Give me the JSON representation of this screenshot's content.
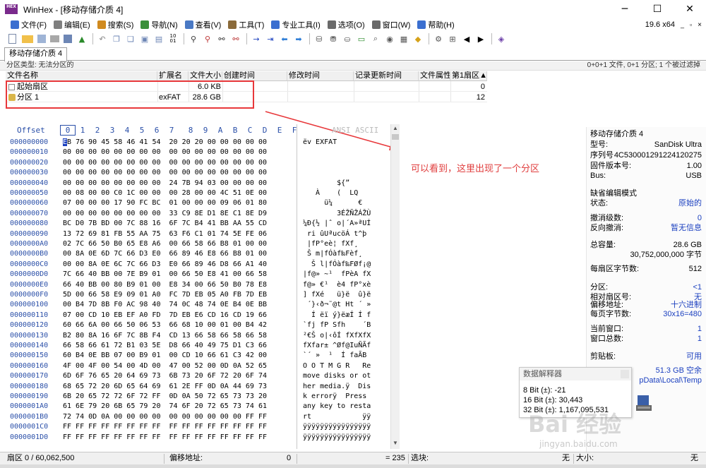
{
  "window": {
    "app_icon_text": "HEX",
    "title": "WinHex - [移动存储介质 4]",
    "minimize_icon": "─",
    "maximize_icon": "☐",
    "close_icon": "✕"
  },
  "menu": {
    "items": [
      "文件(F)",
      "编辑(E)",
      "搜索(S)",
      "导航(N)",
      "查看(V)",
      "工具(T)",
      "专业工具(I)",
      "选项(O)",
      "窗口(W)",
      "帮助(H)"
    ],
    "icon_colors": [
      "#3b6fd0",
      "#7f7f7f",
      "#d08a1f",
      "#3a8f3a",
      "#4a79c4",
      "#8a6a3a",
      "#3b6fd0",
      "#6a6a6a",
      "#6a6a6a",
      "#3b6fd0"
    ],
    "version": "19.6 x64",
    "right_icons": [
      "_",
      "▫",
      "×"
    ]
  },
  "tabs": {
    "active": "移动存储介质 4"
  },
  "partition_info": {
    "left": "分区类型: 无法分区的",
    "right": "0+0+1 文件, 0+1 分区; 1 个被过滤掉"
  },
  "file_table": {
    "headers": [
      "文件名称",
      "扩展名",
      "文件大小",
      "创建时间",
      "修改时间",
      "记录更新时间",
      "文件属性",
      "第1扇区▲"
    ],
    "rows": [
      {
        "name": "起始扇区",
        "ext": "",
        "size": "6.0 KB",
        "created": "",
        "modified": "",
        "record": "",
        "attr": "",
        "sector": "0"
      },
      {
        "name": "分区 1",
        "ext": "exFAT",
        "size": "28.6 GB",
        "created": "",
        "modified": "",
        "record": "",
        "attr": "",
        "sector": "12"
      }
    ]
  },
  "hex": {
    "offset_label": "Offset",
    "columns": [
      "0",
      "1",
      "2",
      "3",
      "4",
      "5",
      "6",
      "7",
      "8",
      "9",
      "A",
      "B",
      "C",
      "D",
      "E",
      "F"
    ],
    "ascii_label": "ANSI ASCII",
    "rows": [
      {
        "off": "000000000",
        "hex": "EB 76 90 45 58 46 41 54  20 20 20 00 00 00 00 00",
        "ascii": "ëv EXFAT"
      },
      {
        "off": "000000010",
        "hex": "00 00 00 00 00 00 00 00  00 00 00 00 00 00 00 00",
        "ascii": ""
      },
      {
        "off": "000000020",
        "hex": "00 00 00 00 00 00 00 00  00 00 00 00 00 00 00 00",
        "ascii": ""
      },
      {
        "off": "000000030",
        "hex": "00 00 00 00 00 00 00 00  00 00 00 00 00 00 00 00",
        "ascii": ""
      },
      {
        "off": "000000040",
        "hex": "00 00 00 00 00 00 00 00  24 7B 94 03 00 00 00 00",
        "ascii": "        ${”"
      },
      {
        "off": "000000050",
        "hex": "00 08 00 00 C0 1C 00 00  00 28 00 00 4C 51 0E 00",
        "ascii": "   À    (  LQ"
      },
      {
        "off": "000000060",
        "hex": "07 00 00 00 17 90 FC BC  01 00 00 00 09 06 01 80",
        "ascii": "     ü¼      €"
      },
      {
        "off": "000000070",
        "hex": "00 00 00 00 00 00 00 00  33 C9 8E D1 8E C1 8E D9",
        "ascii": "        3ÉŽÑŽÁŽÙ"
      },
      {
        "off": "000000080",
        "hex": "BC D0 7B BD 00 7C 88 16  6F 7C B4 41 BB AA 55 CD",
        "ascii": "¼Ð{½ |ˆ o|´A»ªUÍ"
      },
      {
        "off": "000000090",
        "hex": "13 72 69 81 FB 55 AA 75  63 F6 C1 01 74 5E FE 06",
        "ascii": " ri ûUªucöÁ t^þ"
      },
      {
        "off": "0000000A0",
        "hex": "02 7C 66 50 B0 65 E8 A6  00 66 58 66 B8 01 00 00",
        "ascii": " |fP°eè¦ fXf¸"
      },
      {
        "off": "0000000B0",
        "hex": "00 8A 0E 6D 7C 66 D3 E0  66 89 46 E8 66 B8 01 00",
        "ascii": " Š m|fÓàf‰Fèf¸"
      },
      {
        "off": "0000000C0",
        "hex": "00 00 8A 0E 6C 7C 66 D3  E0 66 89 46 D8 66 A1 40",
        "ascii": "  Š l|fÓàf‰FØf¡@"
      },
      {
        "off": "0000000D0",
        "hex": "7C 66 40 BB 00 7E B9 01  00 66 50 E8 41 00 66 58",
        "ascii": "|f@» ~¹  fPèA fX"
      },
      {
        "off": "0000000E0",
        "hex": "66 40 BB 00 80 B9 01 00  E8 34 00 66 50 B0 78 E8",
        "ascii": "f@» €¹  è4 fP°xè"
      },
      {
        "off": "0000000F0",
        "hex": "5D 00 66 58 E9 09 01 A0  FC 7D EB 05 A0 FB 7D EB",
        "ascii": "] fXé   ü}ë  û}ë"
      },
      {
        "off": "000000100",
        "hex": "00 B4 7D 8B F0 AC 98 40  74 0C 48 74 0E B4 0E BB",
        "ascii": " ´}‹ð¬˜@t Ht ´ »"
      },
      {
        "off": "000000110",
        "hex": "07 00 CD 10 EB EF A0 FD  7D EB E6 CD 16 CD 19 66",
        "ascii": "  Í ëï ý}ëæÍ Í f"
      },
      {
        "off": "000000120",
        "hex": "60 66 6A 00 66 50 06 53  66 68 10 00 01 00 B4 42",
        "ascii": "`fj fP Sfh    ´B"
      },
      {
        "off": "000000130",
        "hex": "B2 80 8A 16 6F 7C 8B F4  CD 13 66 58 66 58 66 58",
        "ascii": "²€Š o|‹ôÍ fXfXfX"
      },
      {
        "off": "000000140",
        "hex": "66 58 66 61 72 B1 03 5E  D8 66 40 49 75 D1 C3 66",
        "ascii": "fXfar± ^Øf@IuÑÃf"
      },
      {
        "off": "000000150",
        "hex": "60 B4 0E BB 07 00 B9 01  00 CD 10 66 61 C3 42 00",
        "ascii": "`´ »  ¹  Í faÃB"
      },
      {
        "off": "000000160",
        "hex": "4F 00 4F 00 54 00 4D 00  47 00 52 00 0D 0A 52 65",
        "ascii": "O O T M G R   Re"
      },
      {
        "off": "000000170",
        "hex": "6D 6F 76 65 20 64 69 73  6B 73 20 6F 72 20 6F 74",
        "ascii": "move disks or ot"
      },
      {
        "off": "000000180",
        "hex": "68 65 72 20 6D 65 64 69  61 2E FF 0D 0A 44 69 73",
        "ascii": "her media.ÿ  Dis"
      },
      {
        "off": "000000190",
        "hex": "6B 20 65 72 72 6F 72 FF  0D 0A 50 72 65 73 73 20",
        "ascii": "k errorÿ  Press "
      },
      {
        "off": "0000001A0",
        "hex": "61 6E 79 20 6B 65 79 20  74 6F 20 72 65 73 74 61",
        "ascii": "any key to resta"
      },
      {
        "off": "0000001B0",
        "hex": "72 74 0D 0A 00 00 00 00  00 00 00 00 00 00 FF FF",
        "ascii": "rt            ÿÿ"
      },
      {
        "off": "0000001C0",
        "hex": "FF FF FF FF FF FF FF FF  FF FF FF FF FF FF FF FF",
        "ascii": "ÿÿÿÿÿÿÿÿÿÿÿÿÿÿÿÿ"
      },
      {
        "off": "0000001D0",
        "hex": "FF FF FF FF FF FF FF FF  FF FF FF FF FF FF FF FF",
        "ascii": "ÿÿÿÿÿÿÿÿÿÿÿÿÿÿÿÿ"
      }
    ]
  },
  "annotation": "可以看到，这里出现了一个分区",
  "info_panel": {
    "title": "移动存储介质 4",
    "model_k": "型号:",
    "model_v": "SanDisk Ultra",
    "serial_k": "序列号",
    "serial_v": "4C530001291224120275",
    "fw_k": "固件版本号:",
    "fw_v": "1.00",
    "bus_k": "Bus:",
    "bus_v": "USB",
    "mode_title": "缺省编辑模式",
    "state_k": "状态:",
    "state_v": "原始的",
    "undo_k": "撤消级数:",
    "undo_v": "0",
    "revundo_k": "反向撤消:",
    "revundo_v": "暂无信息",
    "capacity_k": "总容量:",
    "capacity_v": "28.6 GB",
    "capacity_bytes": "30,752,000,000 字节",
    "bps_k": "每扇区字节数:",
    "bps_v": "512",
    "part_k": "分区:",
    "part_v": "<1",
    "relsec_k": "相对扇区号:",
    "relsec_v": "无",
    "offaddr_k": "偏移地址:",
    "offaddr_v": "十六进制",
    "perpage_k": "每页字节数:",
    "perpage_v": "30x16=480",
    "curwin_k": "当前窗口:",
    "curwin_v": "1",
    "totwin_k": "窗口总数:",
    "totwin_v": "1",
    "clip_k": "剪贴板:",
    "clip_v": "可用",
    "free_v": "51.3 GB 空余",
    "temp_v": "pData\\Local\\Temp"
  },
  "interpreter": {
    "title": "数据解释器",
    "line1": "8 Bit (±): -21",
    "line2": "16 Bit (±): 30,443",
    "line3": "32 Bit (±): 1,167,095,531"
  },
  "status": {
    "sector": "扇区 0 / 60,062,500",
    "offset_k": "偏移地址:",
    "offset_v": "0",
    "eq": "= 235",
    "select_k": "选块:",
    "select_v": "无",
    "size_k": "大小:",
    "size_v": "无"
  },
  "watermark": {
    "main": "Bai 经验",
    "url": "jingyan.baidu.com"
  },
  "colors": {
    "highlight_red": "#e8383b",
    "offset_blue": "#2a4fa8",
    "info_blue": "#1a3fbf"
  }
}
